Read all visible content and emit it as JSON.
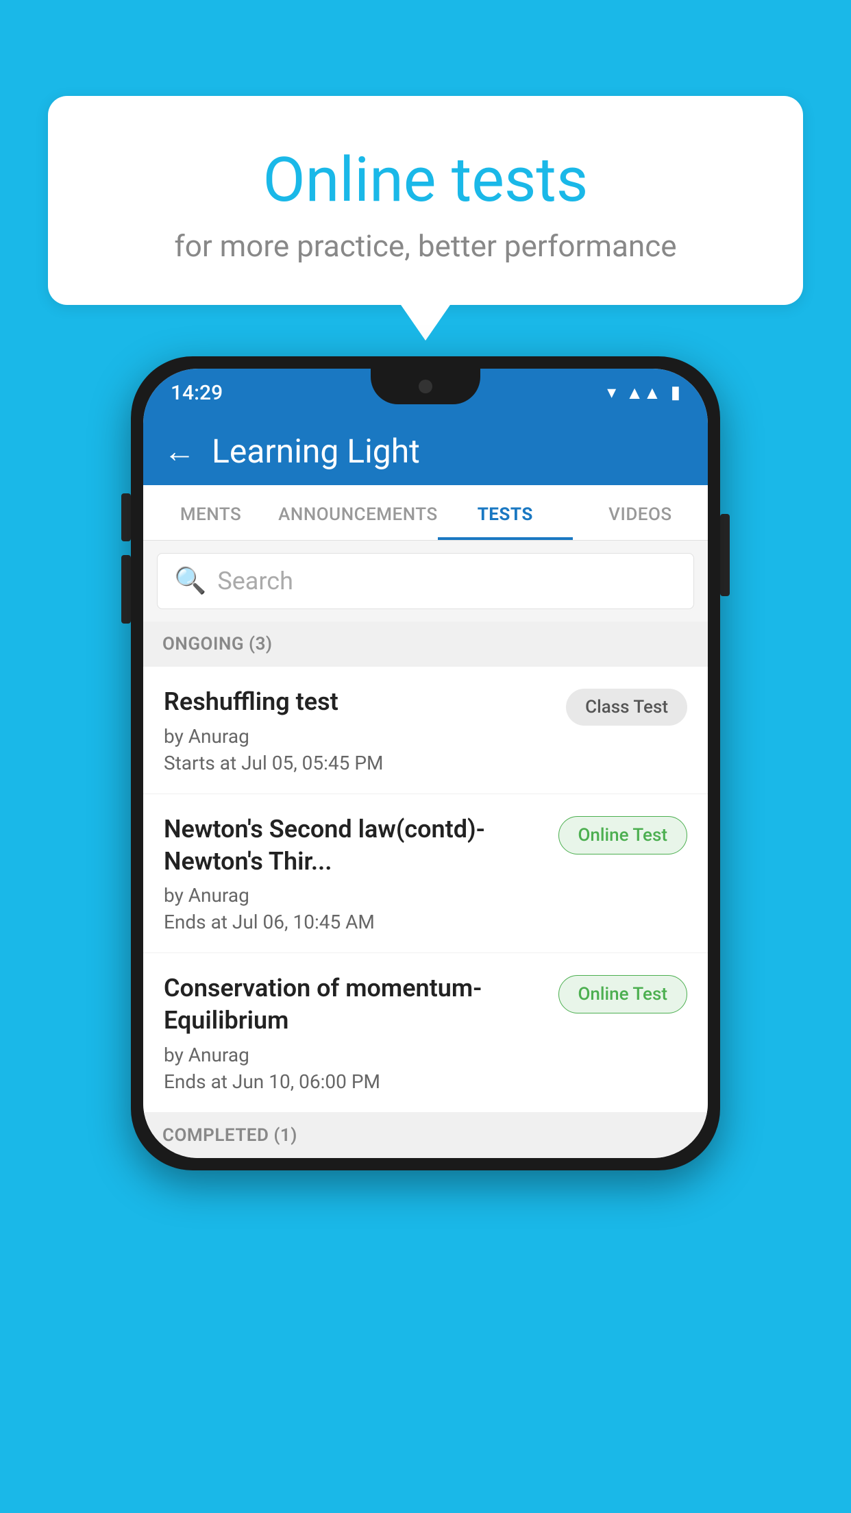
{
  "background_color": "#1ab8e8",
  "bubble": {
    "title": "Online tests",
    "subtitle": "for more practice, better performance"
  },
  "phone": {
    "status_bar": {
      "time": "14:29",
      "icons": [
        "wifi",
        "signal",
        "battery"
      ]
    },
    "header": {
      "back_label": "←",
      "title": "Learning Light"
    },
    "tabs": [
      {
        "label": "MENTS",
        "active": false
      },
      {
        "label": "ANNOUNCEMENTS",
        "active": false
      },
      {
        "label": "TESTS",
        "active": true
      },
      {
        "label": "VIDEOS",
        "active": false
      }
    ],
    "search": {
      "placeholder": "Search"
    },
    "sections": [
      {
        "title": "ONGOING (3)",
        "tests": [
          {
            "title": "Reshuffling test",
            "author": "by Anurag",
            "time_label": "Starts at",
            "time": "Jul 05, 05:45 PM",
            "badge": "Class Test",
            "badge_type": "class"
          },
          {
            "title": "Newton's Second law(contd)-Newton's Thir...",
            "author": "by Anurag",
            "time_label": "Ends at",
            "time": "Jul 06, 10:45 AM",
            "badge": "Online Test",
            "badge_type": "online"
          },
          {
            "title": "Conservation of momentum-Equilibrium",
            "author": "by Anurag",
            "time_label": "Ends at",
            "time": "Jun 10, 06:00 PM",
            "badge": "Online Test",
            "badge_type": "online"
          }
        ]
      }
    ],
    "completed_section": {
      "title": "COMPLETED (1)"
    }
  }
}
